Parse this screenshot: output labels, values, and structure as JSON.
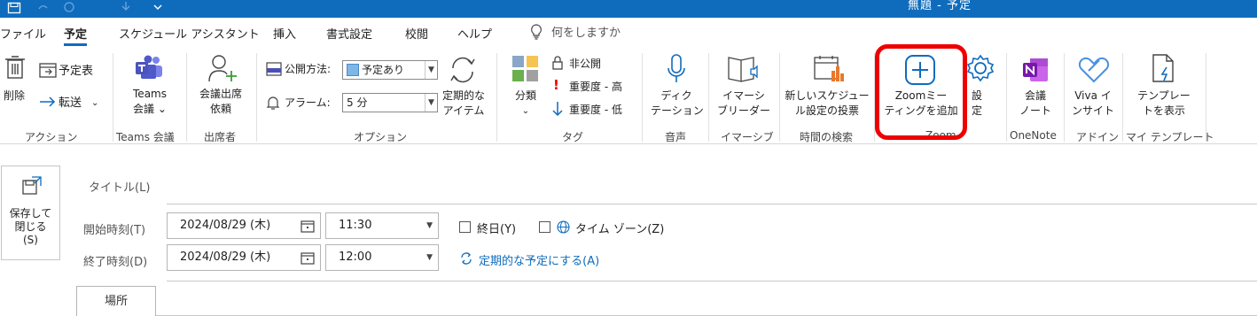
{
  "titlebar": {
    "title": "無題 - 予定",
    "bg_color": "#0f6cbd",
    "quick_access_icons": [
      "save-icon",
      "undo-icon",
      "redo-icon",
      "down-arrow-icon",
      "chevron-down-icon"
    ]
  },
  "tabs": [
    {
      "label": "ファイル",
      "active": false
    },
    {
      "label": "予定",
      "active": true
    },
    {
      "label": "スケジュール アシスタント",
      "active": false
    },
    {
      "label": "挿入",
      "active": false
    },
    {
      "label": "書式設定",
      "active": false
    },
    {
      "label": "校閲",
      "active": false
    },
    {
      "label": "ヘルプ",
      "active": false
    }
  ],
  "tell_me": {
    "placeholder": "何をしますか",
    "icon": "lightbulb-icon"
  },
  "ribbon": {
    "action": {
      "delete": "削除",
      "schedule": "予定表",
      "forward": "転送",
      "group": "アクション"
    },
    "teams": {
      "button_line1": "Teams",
      "button_line2": "会議",
      "group": "Teams 会議"
    },
    "attendees": {
      "button_line1": "会議出席",
      "button_line2": "依頼",
      "group": "出席者"
    },
    "options": {
      "publish_label": "公開方法:",
      "publish_value": "予定あり",
      "alarm_label": "アラーム:",
      "alarm_value": "5 分",
      "recurring_line1": "定期的な",
      "recurring_line2": "アイテム",
      "group": "オプション"
    },
    "tags": {
      "categorize": "分類",
      "private": "非公開",
      "high": "重要度 - 高",
      "low": "重要度 - 低",
      "group": "タグ"
    },
    "voice": {
      "button_line1": "ディク",
      "button_line2": "テーション",
      "group": "音声"
    },
    "immersive": {
      "button_line1": "イマーシ",
      "button_line2": "ブリーダー",
      "group": "イマーシブ"
    },
    "time_search": {
      "button_line1": "新しいスケジュー",
      "button_line2": "ル設定の投票",
      "group": "時間の検索"
    },
    "zoom": {
      "button_line1": "Zoomミー",
      "button_line2": "ティングを追加",
      "settings_line1": "設",
      "settings_line2": "定",
      "group": "Zoom",
      "highlight_color": "#e00000"
    },
    "onenote": {
      "button_line1": "会議",
      "button_line2": "ノート",
      "group": "OneNote"
    },
    "addin": {
      "button_line1": "Viva イ",
      "button_line2": "ンサイト",
      "group": "アドイン"
    },
    "templates": {
      "button_line1": "テンプレー",
      "button_line2": "トを表示",
      "group": "マイ テンプレート"
    }
  },
  "form": {
    "save_close_line1": "保存して",
    "save_close_line2": "閉じる",
    "save_close_line3": "(S)",
    "title_label": "タイトル(L)",
    "start_label": "開始時刻(T)",
    "end_label": "終了時刻(D)",
    "start_date": "2024/08/29 (木)",
    "start_time": "11:30",
    "end_date": "2024/08/29 (木)",
    "end_time": "12:00",
    "all_day": "終日(Y)",
    "timezone": "タイム ゾーン(Z)",
    "recurring_link": "定期的な予定にする(A)",
    "location_label": "場所"
  }
}
